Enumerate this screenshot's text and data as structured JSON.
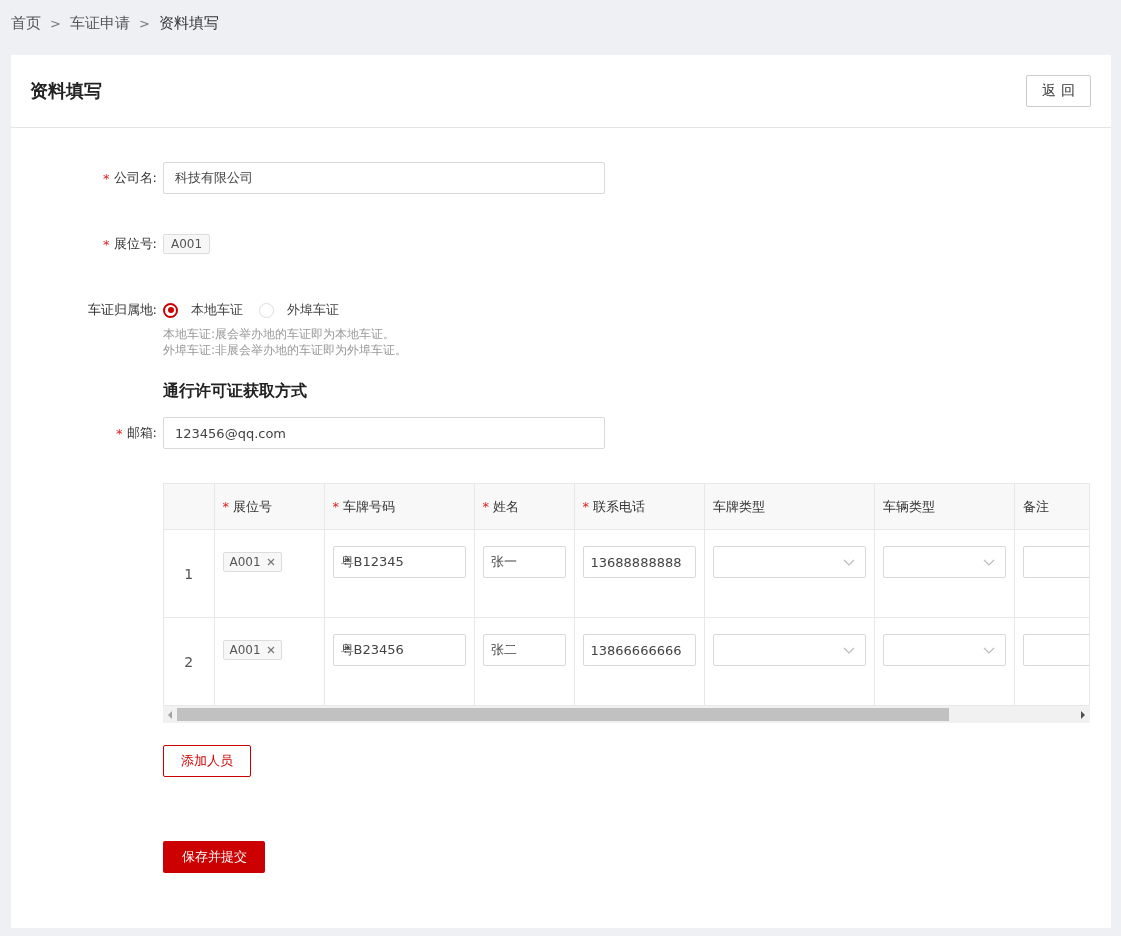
{
  "breadcrumb": [
    {
      "kind": "link",
      "text": "首页"
    },
    {
      "kind": "sep",
      "text": ">"
    },
    {
      "kind": "link",
      "text": "车证申请"
    },
    {
      "kind": "sep",
      "text": ">"
    },
    {
      "kind": "current",
      "text": "资料填写"
    }
  ],
  "card": {
    "title": "资料填写",
    "back_button": "返 回"
  },
  "form": [
    {
      "kind": "input",
      "mark": "*",
      "label": "公司名:",
      "value": "科技有限公司"
    },
    {
      "kind": "tag",
      "mark": "*",
      "label": "展位号:",
      "value": "A001"
    },
    {
      "kind": "radio",
      "label": "车证归属地:",
      "options": [
        {
          "label": "本地车证",
          "selected": true
        },
        {
          "label": "外埠车证",
          "selected": false
        }
      ],
      "hints": [
        "本地车证:展会举办地的车证即为本地车证。",
        "外埠车证:非展会举办地的车证即为外埠车证。"
      ]
    },
    {
      "kind": "section",
      "label": "通行许可证获取方式"
    },
    {
      "kind": "input",
      "mark": "*",
      "label": "邮箱:",
      "value": "123456@qq.com"
    }
  ],
  "table": {
    "columns": [
      "",
      {
        "mark": "*",
        "label": "展位号"
      },
      {
        "mark": "*",
        "label": "车牌号码"
      },
      {
        "mark": "*",
        "label": "姓名"
      },
      {
        "mark": "*",
        "label": "联系电话"
      },
      {
        "label": "车牌类型"
      },
      {
        "label": "车辆类型"
      },
      {
        "label": "备注"
      }
    ],
    "rows": [
      {
        "cells": [
          {
            "kind": "index",
            "text": "1"
          },
          {
            "kind": "tag",
            "text": "A001"
          },
          {
            "kind": "input",
            "value": "粤B12345"
          },
          {
            "kind": "input",
            "value": "张一"
          },
          {
            "kind": "input",
            "value": "13688888888"
          },
          {
            "kind": "select"
          },
          {
            "kind": "select"
          },
          {
            "kind": "input"
          }
        ]
      },
      {
        "cells": [
          {
            "kind": "index",
            "text": "2"
          },
          {
            "kind": "tag",
            "text": "A001"
          },
          {
            "kind": "input",
            "value": "粤B23456"
          },
          {
            "kind": "input",
            "value": "张二"
          },
          {
            "kind": "input",
            "value": "13866666666"
          },
          {
            "kind": "select"
          },
          {
            "kind": "select"
          },
          {
            "kind": "input"
          }
        ]
      }
    ]
  },
  "add_button": "添加人员",
  "submit_button": "保存并提交"
}
